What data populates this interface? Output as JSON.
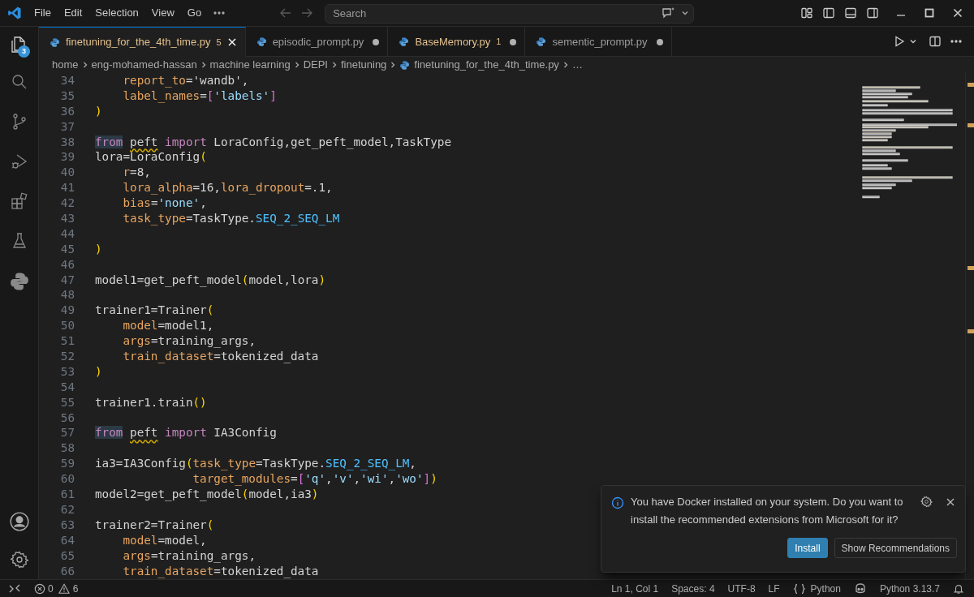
{
  "menu": [
    "File",
    "Edit",
    "Selection",
    "View",
    "Go"
  ],
  "search": {
    "placeholder": "Search"
  },
  "activity_bar": {
    "explorer_badge": "3"
  },
  "tabs": [
    {
      "label": "finetuning_for_the_4th_time.py",
      "selected": true,
      "problems": "5",
      "modified": false
    },
    {
      "label": "episodic_prompt.py",
      "selected": false,
      "modified": true
    },
    {
      "label": "BaseMemory.py",
      "selected": false,
      "problems": "1",
      "modified": true
    },
    {
      "label": "sementic_prompt.py",
      "selected": false,
      "modified": true
    }
  ],
  "breadcrumb": [
    "home",
    "eng-mohamed-hassan",
    "machine learning",
    "DEPI",
    "finetuning",
    "finetuning_for_the_4th_time.py",
    "…"
  ],
  "code": [
    {
      "n": "34",
      "tokens": [
        {
          "kind": "param",
          "text": "    report_to"
        },
        {
          "kind": "plain",
          "text": "='wandb',"
        }
      ]
    },
    {
      "n": "35",
      "tokens": [
        {
          "kind": "param",
          "text": "    label_names"
        },
        {
          "kind": "plain",
          "text": "="
        },
        {
          "kind": "bracket",
          "text": "["
        },
        {
          "kind": "string",
          "text": "'labels'"
        },
        {
          "kind": "bracket",
          "text": "]"
        }
      ]
    },
    {
      "n": "36",
      "tokens": [
        {
          "kind": "paren",
          "text": ")"
        }
      ]
    },
    {
      "n": "37"
    },
    {
      "n": "38",
      "tokens": [
        {
          "kind": "keyword",
          "text": "from",
          "highlighted": true
        },
        {
          "kind": "module",
          "text": " peft"
        },
        {
          "kind": "keyword",
          "text": " import",
          "highlighted": false
        },
        {
          "kind": "plain",
          "text": " LoraConfig,get_peft_model,TaskType"
        }
      ]
    },
    {
      "n": "39",
      "tokens": [
        {
          "kind": "plain",
          "text": "lora=LoraConfig"
        },
        {
          "kind": "paren",
          "text": "("
        }
      ]
    },
    {
      "n": "40",
      "tokens": [
        {
          "kind": "param",
          "text": "    r"
        },
        {
          "kind": "plain",
          "text": "=8,"
        }
      ]
    },
    {
      "n": "41",
      "tokens": [
        {
          "kind": "param",
          "text": "    lora_alpha"
        },
        {
          "kind": "plain",
          "text": "=16,"
        },
        {
          "kind": "param",
          "text": "lora_dropout"
        },
        {
          "kind": "plain",
          "text": "=.1,"
        }
      ]
    },
    {
      "n": "42",
      "tokens": [
        {
          "kind": "param",
          "text": "    bias"
        },
        {
          "kind": "plain",
          "text": "="
        },
        {
          "kind": "string",
          "text": "'none'"
        },
        {
          "kind": "plain",
          "text": ","
        }
      ]
    },
    {
      "n": "43",
      "tokens": [
        {
          "kind": "param",
          "text": "    task_type"
        },
        {
          "kind": "plain",
          "text": "=TaskType."
        },
        {
          "kind": "const",
          "text": "SEQ_2_SEQ_LM"
        }
      ]
    },
    {
      "n": "44"
    },
    {
      "n": "45",
      "tokens": [
        {
          "kind": "paren",
          "text": ")"
        }
      ]
    },
    {
      "n": "46"
    },
    {
      "n": "47",
      "tokens": [
        {
          "kind": "plain",
          "text": "model1=get_peft_model"
        },
        {
          "kind": "paren",
          "text": "("
        },
        {
          "kind": "plain",
          "text": "model,lora"
        },
        {
          "kind": "paren",
          "text": ")"
        }
      ]
    },
    {
      "n": "48"
    },
    {
      "n": "49",
      "tokens": [
        {
          "kind": "plain",
          "text": "trainer1=Trainer"
        },
        {
          "kind": "paren",
          "text": "("
        }
      ]
    },
    {
      "n": "50",
      "tokens": [
        {
          "kind": "param",
          "text": "    model"
        },
        {
          "kind": "plain",
          "text": "=model1,"
        }
      ]
    },
    {
      "n": "51",
      "tokens": [
        {
          "kind": "param",
          "text": "    args"
        },
        {
          "kind": "plain",
          "text": "=training_args,"
        }
      ]
    },
    {
      "n": "52",
      "tokens": [
        {
          "kind": "param",
          "text": "    train_dataset"
        },
        {
          "kind": "plain",
          "text": "=tokenized_data"
        }
      ]
    },
    {
      "n": "53",
      "tokens": [
        {
          "kind": "paren",
          "text": ")"
        }
      ]
    },
    {
      "n": "54"
    },
    {
      "n": "55",
      "tokens": [
        {
          "kind": "plain",
          "text": "trainer1.train"
        },
        {
          "kind": "paren",
          "text": "()"
        }
      ]
    },
    {
      "n": "56"
    },
    {
      "n": "57",
      "tokens": [
        {
          "kind": "keyword",
          "text": "from",
          "highlighted": true
        },
        {
          "kind": "module",
          "text": " peft"
        },
        {
          "kind": "keyword",
          "text": " import",
          "highlighted": false
        },
        {
          "kind": "plain",
          "text": " IA3Config"
        }
      ]
    },
    {
      "n": "58"
    },
    {
      "n": "59",
      "tokens": [
        {
          "kind": "plain",
          "text": "ia3=IA3Config"
        },
        {
          "kind": "paren",
          "text": "("
        },
        {
          "kind": "param",
          "text": "task_type"
        },
        {
          "kind": "plain",
          "text": "=TaskType."
        },
        {
          "kind": "const",
          "text": "SEQ_2_SEQ_LM"
        },
        {
          "kind": "plain",
          "text": ","
        }
      ]
    },
    {
      "n": "60",
      "tokens": [
        {
          "kind": "param",
          "text": "              target_modules"
        },
        {
          "kind": "plain",
          "text": "="
        },
        {
          "kind": "bracket",
          "text": "["
        },
        {
          "kind": "string",
          "text": "'q'"
        },
        {
          "kind": "plain",
          "text": ","
        },
        {
          "kind": "string",
          "text": "'v'"
        },
        {
          "kind": "plain",
          "text": ","
        },
        {
          "kind": "string",
          "text": "'wi'"
        },
        {
          "kind": "plain",
          "text": ","
        },
        {
          "kind": "string",
          "text": "'wo'"
        },
        {
          "kind": "bracket",
          "text": "]"
        },
        {
          "kind": "paren",
          "text": ")"
        }
      ]
    },
    {
      "n": "61",
      "tokens": [
        {
          "kind": "plain",
          "text": "model2=get_peft_model"
        },
        {
          "kind": "paren",
          "text": "("
        },
        {
          "kind": "plain",
          "text": "model,ia3"
        },
        {
          "kind": "paren",
          "text": ")"
        }
      ]
    },
    {
      "n": "62"
    },
    {
      "n": "63",
      "tokens": [
        {
          "kind": "plain",
          "text": "trainer2=Trainer"
        },
        {
          "kind": "paren",
          "text": "("
        }
      ]
    },
    {
      "n": "64",
      "tokens": [
        {
          "kind": "param",
          "text": "    model"
        },
        {
          "kind": "plain",
          "text": "=model,"
        }
      ]
    },
    {
      "n": "65",
      "tokens": [
        {
          "kind": "param",
          "text": "    args"
        },
        {
          "kind": "plain",
          "text": "=training_args,"
        }
      ]
    },
    {
      "n": "66",
      "tokens": [
        {
          "kind": "param",
          "text": "    train_dataset"
        },
        {
          "kind": "plain",
          "text": "=tokenized_data"
        }
      ]
    }
  ],
  "notification": {
    "message": "You have Docker installed on your system. Do you want to install the recommended extensions from Microsoft for it?",
    "buttons": [
      {
        "label": "Install",
        "kind": "primary"
      },
      {
        "label": "Show Recommendations",
        "kind": "secondary"
      }
    ]
  },
  "status_bar": {
    "errors": "0",
    "warnings": "6",
    "items": [
      "Ln 1, Col 1",
      "Spaces: 4",
      "UTF-8",
      "LF"
    ],
    "language": "Python",
    "interpreter": "Python 3.13.7"
  }
}
